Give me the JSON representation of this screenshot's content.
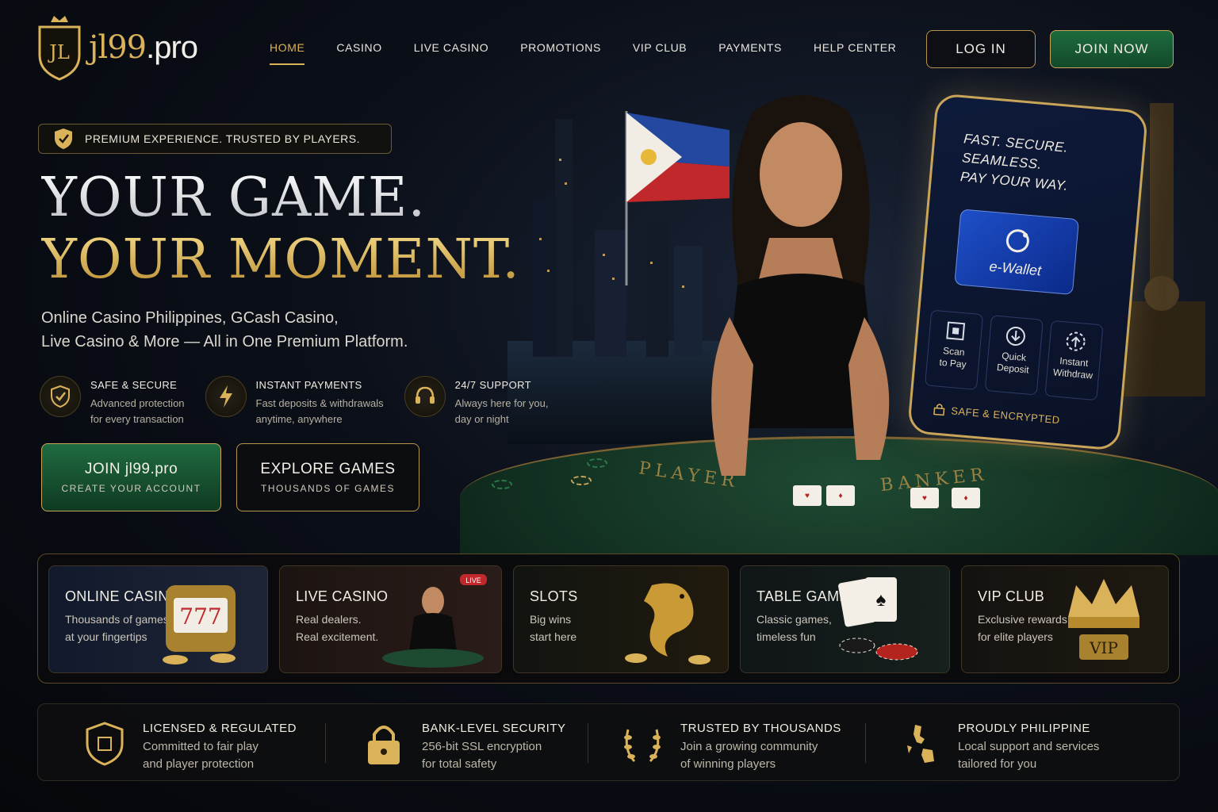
{
  "brand": {
    "name": "jl99",
    "tld": ".pro",
    "badge_letters": "JL"
  },
  "nav": {
    "items": [
      "HOME",
      "CASINO",
      "LIVE CASINO",
      "PROMOTIONS",
      "VIP CLUB",
      "PAYMENTS",
      "HELP CENTER"
    ],
    "active": "HOME"
  },
  "header": {
    "login_label": "LOG IN",
    "join_label": "JOIN NOW"
  },
  "hero": {
    "badge": "PREMIUM EXPERIENCE. TRUSTED BY PLAYERS.",
    "headline_line1": "YOUR GAME.",
    "headline_line2": "YOUR MOMENT.",
    "subtitle_line1": "Online Casino Philippines, GCash Casino,",
    "subtitle_line2": "Live Casino & More — All in One Premium Platform.",
    "features": [
      {
        "icon": "shield-check-icon",
        "title": "SAFE & SECURE",
        "desc1": "Advanced protection",
        "desc2": "for every transaction"
      },
      {
        "icon": "lightning-icon",
        "title": "INSTANT PAYMENTS",
        "desc1": "Fast deposits & withdrawals",
        "desc2": "anytime, anywhere"
      },
      {
        "icon": "headset-icon",
        "title": "24/7 SUPPORT",
        "desc1": "Always here for you,",
        "desc2": "day or night"
      }
    ],
    "cta_primary": {
      "label": "JOIN jl99.pro",
      "sub": "CREATE YOUR ACCOUNT"
    },
    "cta_secondary": {
      "label": "EXPLORE GAMES",
      "sub": "THOUSANDS OF GAMES"
    }
  },
  "scene": {
    "table_labels": [
      "PLAYER",
      "BANKER"
    ],
    "phone": {
      "slogan_line1": "FAST. SECURE.",
      "slogan_line2": "SEAMLESS.",
      "slogan_line3": "PAY YOUR WAY.",
      "wallet_label": "e-Wallet",
      "actions": [
        {
          "icon": "qr-scan-icon",
          "line1": "Scan",
          "line2": "to Pay"
        },
        {
          "icon": "deposit-icon",
          "line1": "Quick",
          "line2": "Deposit"
        },
        {
          "icon": "withdraw-icon",
          "line1": "Instant",
          "line2": "Withdraw"
        }
      ],
      "secure_label": "SAFE & ENCRYPTED"
    }
  },
  "categories": [
    {
      "title": "ONLINE CASINO",
      "desc1": "Thousands of games",
      "desc2": "at your fingertips",
      "art": "slot-machine-icon"
    },
    {
      "title": "LIVE CASINO",
      "desc1": "Real dealers.",
      "desc2": "Real excitement.",
      "art": "live-dealer-icon",
      "badge": "LIVE"
    },
    {
      "title": "SLOTS",
      "desc1": "Big wins",
      "desc2": "start here",
      "art": "dragon-icon"
    },
    {
      "title": "TABLE GAMES",
      "desc1": "Classic games,",
      "desc2": "timeless fun",
      "art": "cards-chips-icon"
    },
    {
      "title": "VIP CLUB",
      "desc1": "Exclusive rewards",
      "desc2": "for elite players",
      "art": "crown-icon",
      "art_text": "VIP"
    }
  ],
  "trust": [
    {
      "icon": "shield-badge-icon",
      "title": "LICENSED & REGULATED",
      "desc1": "Committed to fair play",
      "desc2": "and player protection"
    },
    {
      "icon": "padlock-icon",
      "title": "BANK-LEVEL SECURITY",
      "desc1": "256-bit SSL encryption",
      "desc2": "for total safety"
    },
    {
      "icon": "laurel-icon",
      "title": "TRUSTED BY THOUSANDS",
      "desc1": "Join a growing community",
      "desc2": "of winning players"
    },
    {
      "icon": "philippines-map-icon",
      "title": "PROUDLY PHILIPPINE",
      "desc1": "Local support and services",
      "desc2": "tailored for you"
    }
  ],
  "colors": {
    "gold": "#d9b25a",
    "green": "#1e6b3e",
    "background": "#05070b"
  }
}
